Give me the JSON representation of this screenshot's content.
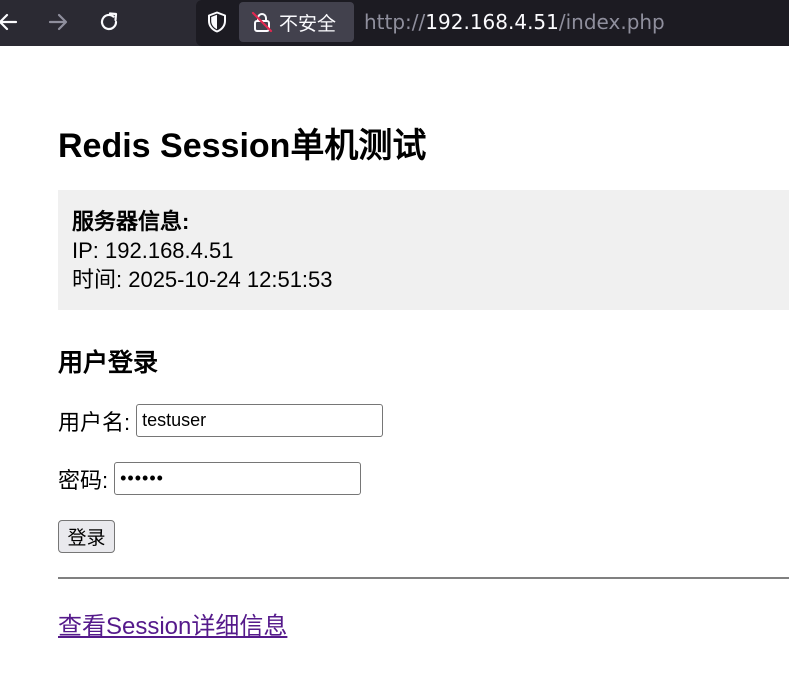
{
  "browser": {
    "security_label": "不安全",
    "url_scheme": "http://",
    "url_host": "192.168.4.51",
    "url_path": "/index.php"
  },
  "page": {
    "title": "Redis Session单机测试",
    "server_info": {
      "heading": "服务器信息:",
      "ip_line": "IP: 192.168.4.51",
      "time_line": "时间: 2025-10-24 12:51:53"
    },
    "login": {
      "section_title": "用户登录",
      "username_label": "用户名:",
      "username_value": "testuser",
      "password_label": "密码:",
      "password_value": "••••••",
      "submit_label": "登录"
    },
    "session_link": "查看Session详细信息"
  },
  "colors": {
    "toolbar_bg": "#2b2a33",
    "info_box_bg": "#f0f0f0",
    "visited_link": "#551a8b"
  }
}
